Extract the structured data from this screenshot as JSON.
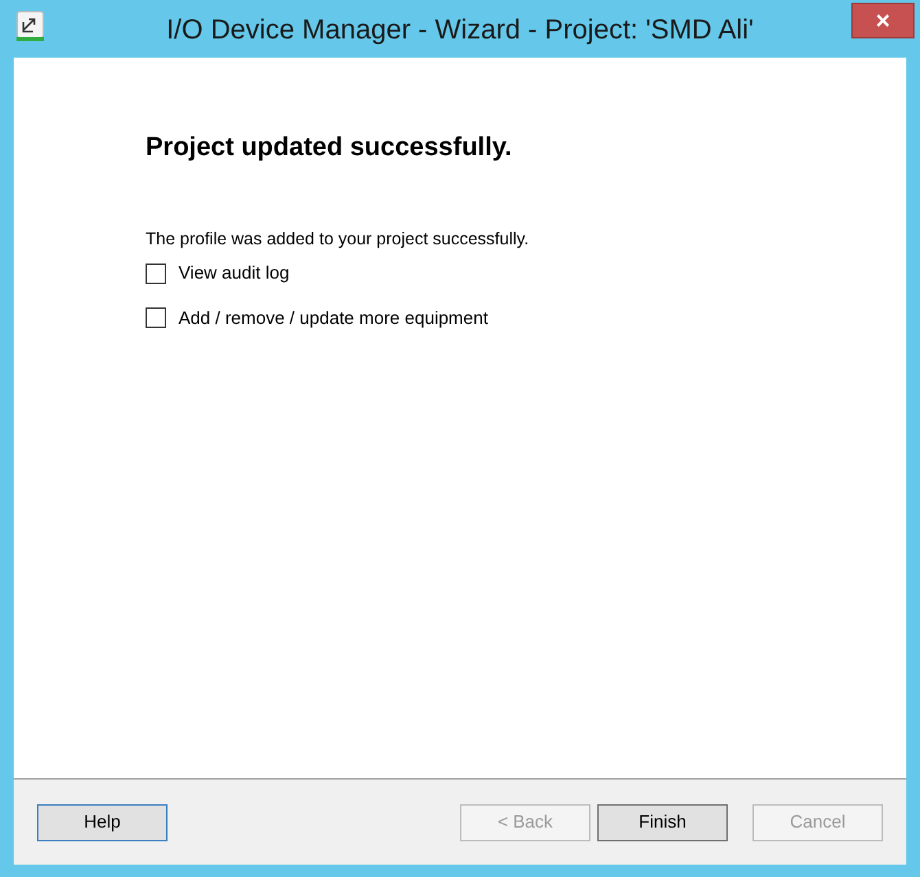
{
  "window": {
    "title": "I/O Device Manager - Wizard - Project: 'SMD Ali'",
    "close": "×"
  },
  "heading": "Project updated successfully.",
  "message": "The profile was added to your project successfully.",
  "options": [
    {
      "label": "View audit log",
      "checked": false
    },
    {
      "label": "Add / remove / update more equipment",
      "checked": false
    }
  ],
  "buttons": [
    {
      "label": "Help",
      "disabled": false,
      "focused": true
    },
    {
      "label": "< Back",
      "disabled": true,
      "focused": false
    },
    {
      "label": "Finish",
      "disabled": false,
      "focused": false
    },
    {
      "label": "Cancel",
      "disabled": true,
      "focused": false
    }
  ]
}
